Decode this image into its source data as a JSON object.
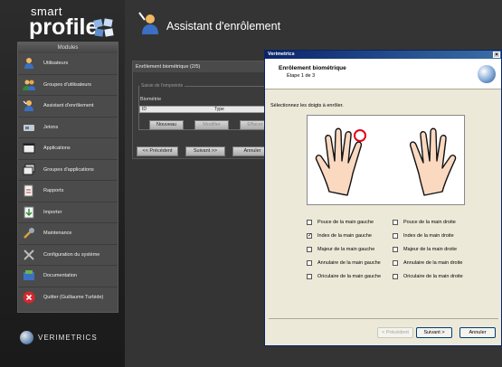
{
  "logo": {
    "small": "smart",
    "big": "profile"
  },
  "modules": {
    "header": "Modules",
    "items": [
      {
        "label": "Utilisateurs",
        "icon": "user-icon"
      },
      {
        "label": "Groupes d'utilisateurs",
        "icon": "user-group-icon"
      },
      {
        "label": "Assistant d'enrôlement",
        "icon": "enrollment-icon"
      },
      {
        "label": "Jetons",
        "icon": "token-icon"
      },
      {
        "label": "Applications",
        "icon": "application-icon"
      },
      {
        "label": "Groupes d'applications",
        "icon": "application-group-icon"
      },
      {
        "label": "Rapports",
        "icon": "report-icon"
      },
      {
        "label": "Importer",
        "icon": "import-icon"
      },
      {
        "label": "Maintenance",
        "icon": "maintenance-icon"
      },
      {
        "label": "Configuration du système",
        "icon": "settings-tools-icon"
      },
      {
        "label": "Documentation",
        "icon": "documentation-icon"
      },
      {
        "label": "Quitter (Guillaume Turbide)",
        "icon": "quit-icon"
      }
    ]
  },
  "brand": "VERIMETRICS",
  "page": {
    "title": "Assistant d'enrôlement"
  },
  "enrollment": {
    "header": "Enrôlement biométrique (2/5)",
    "legend": "Saisie de l'empreinte",
    "biometrie_label": "Biométrie",
    "columns": [
      "ID",
      "Type",
      "Effacer"
    ],
    "buttons": {
      "new": "Nouveau",
      "modify": "Modifier",
      "delete": "Effacer"
    },
    "nav": {
      "prev": "<< Précédent",
      "next": "Suivant >>",
      "cancel": "Annuler"
    }
  },
  "dialog": {
    "title": "Verimetrics",
    "heading": "Enrôlement biométrique",
    "step": "Étape 1 de 3",
    "instruction": "Sélectionnez les doigts à enrôler.",
    "left_fingers": [
      {
        "label": "Pouce de la main gauche",
        "checked": false
      },
      {
        "label": "Index de la main gauche",
        "checked": true
      },
      {
        "label": "Majeur de la main gauche",
        "checked": false
      },
      {
        "label": "Annulaire de la main gauche",
        "checked": false
      },
      {
        "label": "Oriculaire de la main gauche",
        "checked": false
      }
    ],
    "right_fingers": [
      {
        "label": "Pouce de la main droite",
        "checked": false
      },
      {
        "label": "Index de la main droite",
        "checked": false
      },
      {
        "label": "Majeur de la main droite",
        "checked": false
      },
      {
        "label": "Annulaire de la main droite",
        "checked": false
      },
      {
        "label": "Oriculaire de la main droite",
        "checked": false
      }
    ],
    "buttons": {
      "prev": "< Précédent",
      "next": "Suivant >",
      "cancel": "Annuler"
    },
    "selection_marker_color": "#e0001b"
  }
}
